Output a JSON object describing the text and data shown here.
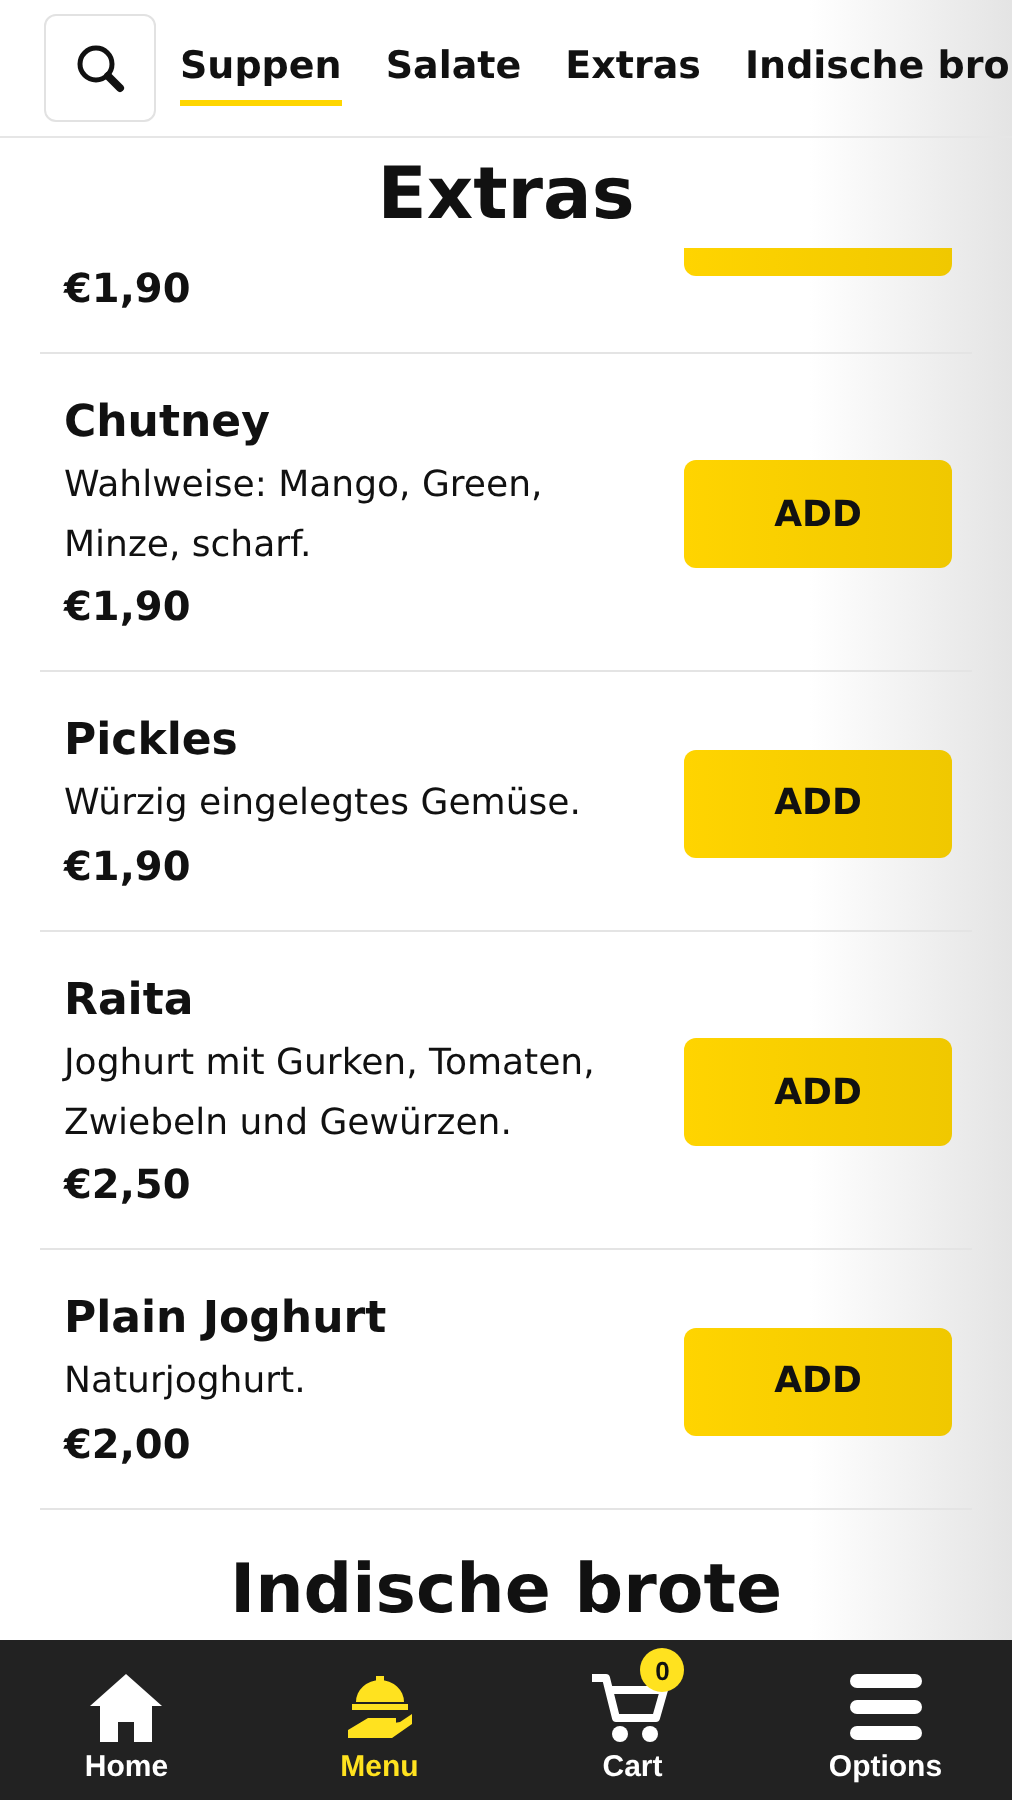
{
  "tabs": [
    {
      "label": "Suppen",
      "selected": true
    },
    {
      "label": "Salate",
      "selected": false
    },
    {
      "label": "Extras",
      "selected": false
    },
    {
      "label": "Indische bro",
      "selected": false
    }
  ],
  "section": {
    "title": "Extras",
    "items": [
      {
        "price": "€1,90",
        "kind": "partial"
      },
      {
        "kind": "full",
        "name": "Chutney",
        "description": "Wahlweise: Mango, Green, Minze, scharf.",
        "price": "€1,90",
        "button": "ADD"
      },
      {
        "kind": "full",
        "name": "Pickles",
        "description": "Würzig eingelegtes Gemüse.",
        "price": "€1,90",
        "button": "ADD"
      },
      {
        "kind": "full",
        "name": "Raita",
        "description": "Joghurt mit Gurken, Tomaten, Zwiebeln und Gewürzen.",
        "price": "€2,50",
        "button": "ADD"
      },
      {
        "kind": "full",
        "name": "Plain Joghurt",
        "description": "Naturjoghurt.",
        "price": "€2,00",
        "button": "ADD"
      }
    ]
  },
  "next_section": {
    "title": "Indische brote"
  },
  "nav": [
    {
      "label": "Home",
      "kind": "home",
      "selected": false
    },
    {
      "label": "Menu",
      "kind": "menu",
      "selected": true
    },
    {
      "label": "Cart",
      "kind": "cart",
      "selected": false,
      "badge": "0"
    },
    {
      "label": "Options",
      "kind": "options",
      "selected": false
    }
  ]
}
